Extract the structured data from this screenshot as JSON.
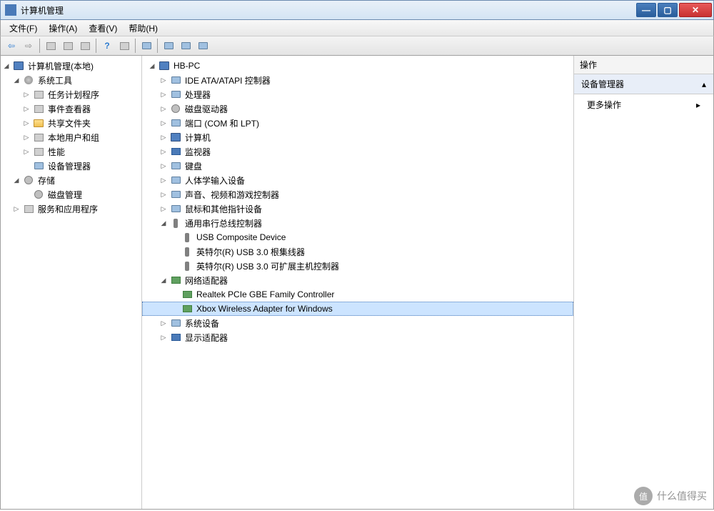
{
  "window": {
    "title": "计算机管理"
  },
  "menu": {
    "file": "文件(F)",
    "action": "操作(A)",
    "view": "查看(V)",
    "help": "帮助(H)"
  },
  "left_tree": {
    "root": "计算机管理(本地)",
    "system_tools": "系统工具",
    "task_scheduler": "任务计划程序",
    "event_viewer": "事件查看器",
    "shared_folders": "共享文件夹",
    "local_users": "本地用户和组",
    "performance": "性能",
    "device_manager": "设备管理器",
    "storage": "存储",
    "disk_management": "磁盘管理",
    "services_apps": "服务和应用程序"
  },
  "mid_tree": {
    "root": "HB-PC",
    "ide": "IDE ATA/ATAPI 控制器",
    "cpu": "处理器",
    "disk_drives": "磁盘驱动器",
    "ports": "端口 (COM 和 LPT)",
    "computer": "计算机",
    "monitors": "监视器",
    "keyboards": "键盘",
    "hid": "人体学输入设备",
    "sound": "声音、视频和游戏控制器",
    "mice": "鼠标和其他指针设备",
    "usb": "通用串行总线控制器",
    "usb_composite": "USB Composite Device",
    "usb_root": "英特尔(R) USB 3.0 根集线器",
    "usb_host": "英特尔(R) USB 3.0 可扩展主机控制器",
    "network": "网络适配器",
    "realtek": "Realtek PCIe GBE Family Controller",
    "xbox": "Xbox Wireless Adapter for Windows",
    "system_devices": "系统设备",
    "display": "显示适配器"
  },
  "right_pane": {
    "header": "操作",
    "section": "设备管理器",
    "more": "更多操作"
  },
  "watermark": {
    "badge": "值",
    "text": "什么值得买"
  }
}
